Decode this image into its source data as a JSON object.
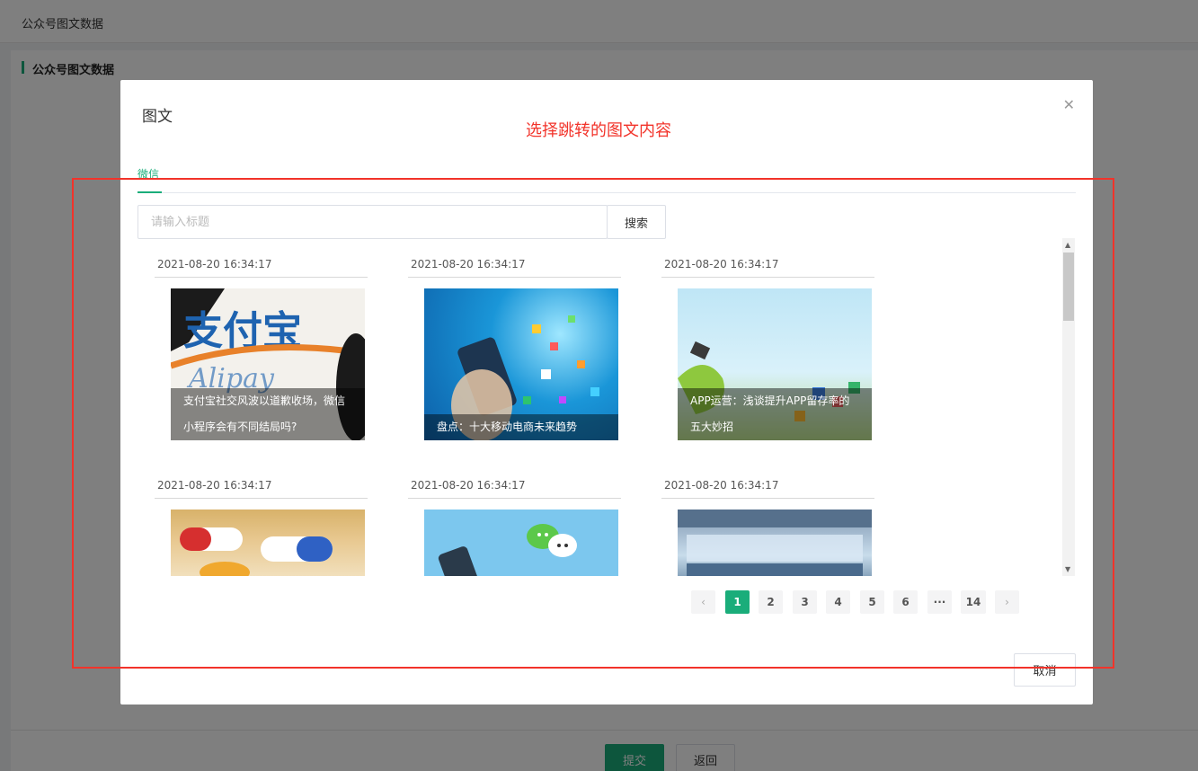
{
  "page": {
    "breadcrumb": "公众号图文数据",
    "section_title": "公众号图文数据",
    "submit_label": "提交",
    "back_label": "返回"
  },
  "modal": {
    "title": "图文",
    "close_icon": "close-icon",
    "annotation": "选择跳转的图文内容",
    "tabs": [
      {
        "label": "微信",
        "active": true
      }
    ],
    "search": {
      "placeholder": "请输入标题",
      "value": "",
      "button_label": "搜索"
    },
    "articles": [
      {
        "date": "2021-08-20 16:34:17",
        "caption": "支付宝社交风波以道歉收场，微信小程序会有不同结局吗?",
        "thumb": "alipay-logo-image"
      },
      {
        "date": "2021-08-20 16:34:17",
        "caption": "盘点：十大移动电商未来趋势",
        "thumb": "hand-holding-phone-image"
      },
      {
        "date": "2021-08-20 16:34:17",
        "caption": "APP运营：浅谈提升APP留存率的五大妙招",
        "thumb": "app-icons-sky-image"
      },
      {
        "date": "2021-08-20 16:34:17",
        "caption": "",
        "thumb": "pills-image"
      },
      {
        "date": "2021-08-20 16:34:17",
        "caption": "",
        "thumb": "wechat-phone-image"
      },
      {
        "date": "2021-08-20 16:34:17",
        "caption": "",
        "thumb": "cross-border-ecommerce-image"
      }
    ],
    "pagination": {
      "prev_icon": "chevron-left-icon",
      "pages": [
        "1",
        "2",
        "3",
        "4",
        "5",
        "6",
        "···",
        "14"
      ],
      "current": "1",
      "next_icon": "chevron-right-icon"
    },
    "cancel_label": "取消"
  },
  "colors": {
    "accent": "#1aad7a",
    "annotation": "#f2332a",
    "overlay": "rgba(0,0,0,0.5)"
  }
}
